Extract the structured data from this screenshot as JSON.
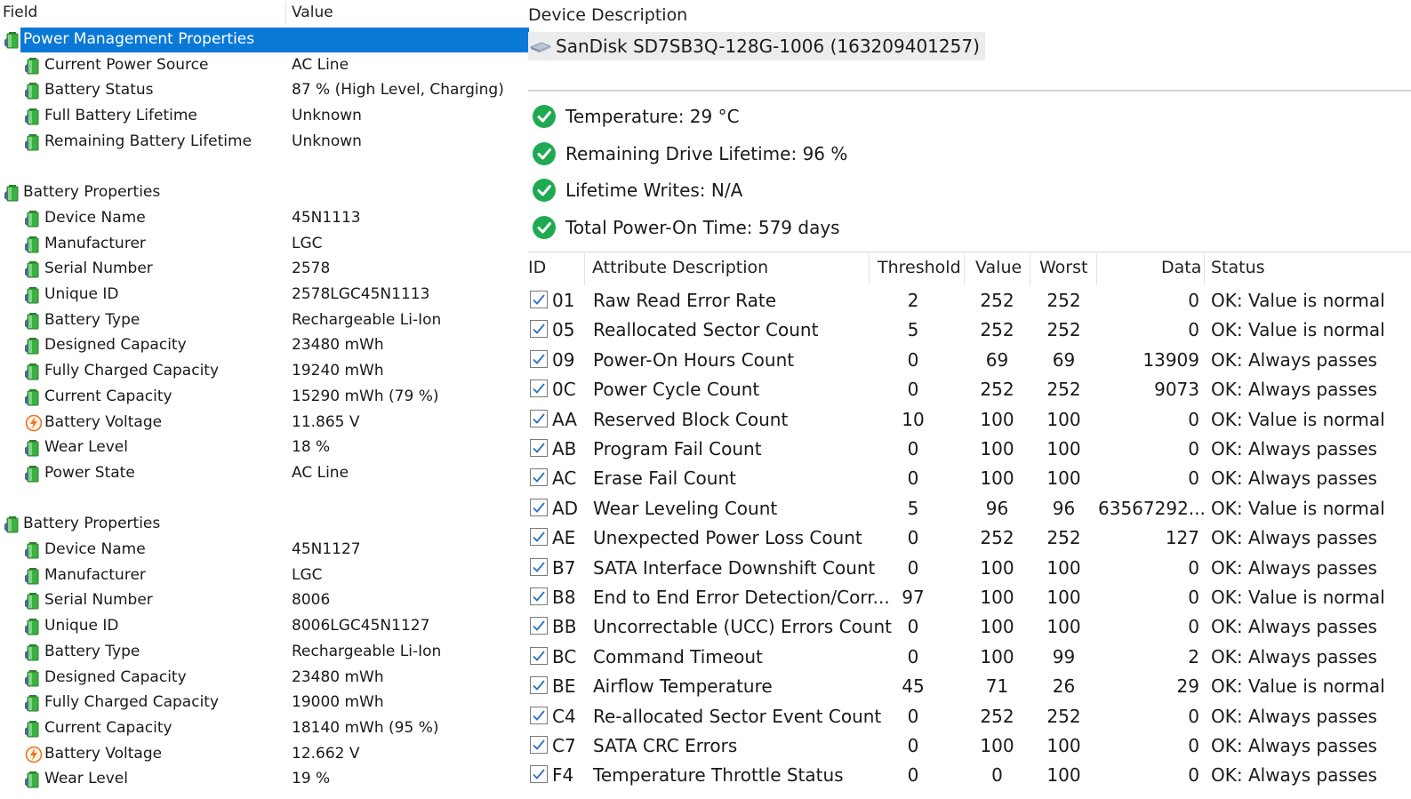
{
  "left_panel": {
    "header": {
      "field": "Field",
      "value": "Value"
    },
    "rows": [
      {
        "type": "group",
        "label": "Power Management Properties",
        "value": "",
        "icon": "battery-icon",
        "selected": true
      },
      {
        "type": "child",
        "label": "Current Power Source",
        "value": "AC Line",
        "icon": "battery-icon"
      },
      {
        "type": "child",
        "label": "Battery Status",
        "value": "87 % (High Level, Charging)",
        "icon": "battery-icon"
      },
      {
        "type": "child",
        "label": "Full Battery Lifetime",
        "value": "Unknown",
        "icon": "battery-icon"
      },
      {
        "type": "child",
        "label": "Remaining Battery Lifetime",
        "value": "Unknown",
        "icon": "battery-icon"
      },
      {
        "type": "blank"
      },
      {
        "type": "group",
        "label": "Battery Properties",
        "value": "",
        "icon": "battery-icon"
      },
      {
        "type": "child",
        "label": "Device Name",
        "value": "45N1113",
        "icon": "battery-icon"
      },
      {
        "type": "child",
        "label": "Manufacturer",
        "value": "LGC",
        "icon": "battery-icon"
      },
      {
        "type": "child",
        "label": "Serial Number",
        "value": "2578",
        "icon": "battery-icon"
      },
      {
        "type": "child",
        "label": "Unique ID",
        "value": "2578LGC45N1113",
        "icon": "battery-icon"
      },
      {
        "type": "child",
        "label": "Battery Type",
        "value": "Rechargeable Li-Ion",
        "icon": "battery-icon"
      },
      {
        "type": "child",
        "label": "Designed Capacity",
        "value": "23480 mWh",
        "icon": "battery-icon"
      },
      {
        "type": "child",
        "label": "Fully Charged Capacity",
        "value": "19240 mWh",
        "icon": "battery-icon"
      },
      {
        "type": "child",
        "label": "Current Capacity",
        "value": "15290 mWh  (79 %)",
        "icon": "battery-icon"
      },
      {
        "type": "child",
        "label": "Battery Voltage",
        "value": "11.865 V",
        "icon": "voltage-icon"
      },
      {
        "type": "child",
        "label": "Wear Level",
        "value": "18 %",
        "icon": "battery-icon"
      },
      {
        "type": "child",
        "label": "Power State",
        "value": "AC Line",
        "icon": "battery-icon"
      },
      {
        "type": "blank"
      },
      {
        "type": "group",
        "label": "Battery Properties",
        "value": "",
        "icon": "battery-icon"
      },
      {
        "type": "child",
        "label": "Device Name",
        "value": "45N1127",
        "icon": "battery-icon"
      },
      {
        "type": "child",
        "label": "Manufacturer",
        "value": "LGC",
        "icon": "battery-icon"
      },
      {
        "type": "child",
        "label": "Serial Number",
        "value": "8006",
        "icon": "battery-icon"
      },
      {
        "type": "child",
        "label": "Unique ID",
        "value": "8006LGC45N1127",
        "icon": "battery-icon"
      },
      {
        "type": "child",
        "label": "Battery Type",
        "value": "Rechargeable Li-Ion",
        "icon": "battery-icon"
      },
      {
        "type": "child",
        "label": "Designed Capacity",
        "value": "23480 mWh",
        "icon": "battery-icon"
      },
      {
        "type": "child",
        "label": "Fully Charged Capacity",
        "value": "19000 mWh",
        "icon": "battery-icon"
      },
      {
        "type": "child",
        "label": "Current Capacity",
        "value": "18140 mWh  (95 %)",
        "icon": "battery-icon"
      },
      {
        "type": "child",
        "label": "Battery Voltage",
        "value": "12.662 V",
        "icon": "voltage-icon"
      },
      {
        "type": "child",
        "label": "Wear Level",
        "value": "19 %",
        "icon": "battery-icon"
      }
    ]
  },
  "right_panel": {
    "device_description_label": "Device Description",
    "device_name": "SanDisk SD7SB3Q-128G-1006 (163209401257)",
    "device_icon": "drive-icon",
    "status_items": [
      {
        "text": "Temperature: 29 °C",
        "icon": "ok-check-icon"
      },
      {
        "text": "Remaining Drive Lifetime: 96 %",
        "icon": "ok-check-icon"
      },
      {
        "text": "Lifetime Writes: N/A",
        "icon": "ok-check-icon"
      },
      {
        "text": "Total Power-On Time: 579 days",
        "icon": "ok-check-icon"
      }
    ],
    "table": {
      "headers": {
        "id": "ID",
        "description": "Attribute Description",
        "threshold": "Threshold",
        "value": "Value",
        "worst": "Worst",
        "data": "Data",
        "status": "Status"
      },
      "rows": [
        {
          "id": "01",
          "description": "Raw Read Error Rate",
          "threshold": "2",
          "value": "252",
          "worst": "252",
          "data": "0",
          "status": "OK: Value is normal",
          "checked": true
        },
        {
          "id": "05",
          "description": "Reallocated Sector Count",
          "threshold": "5",
          "value": "252",
          "worst": "252",
          "data": "0",
          "status": "OK: Value is normal",
          "checked": true
        },
        {
          "id": "09",
          "description": "Power-On Hours Count",
          "threshold": "0",
          "value": "69",
          "worst": "69",
          "data": "13909",
          "status": "OK: Always passes",
          "checked": true
        },
        {
          "id": "0C",
          "description": "Power Cycle Count",
          "threshold": "0",
          "value": "252",
          "worst": "252",
          "data": "9073",
          "status": "OK: Always passes",
          "checked": true
        },
        {
          "id": "AA",
          "description": "Reserved Block Count",
          "threshold": "10",
          "value": "100",
          "worst": "100",
          "data": "0",
          "status": "OK: Value is normal",
          "checked": true
        },
        {
          "id": "AB",
          "description": "Program Fail Count",
          "threshold": "0",
          "value": "100",
          "worst": "100",
          "data": "0",
          "status": "OK: Always passes",
          "checked": true
        },
        {
          "id": "AC",
          "description": "Erase Fail Count",
          "threshold": "0",
          "value": "100",
          "worst": "100",
          "data": "0",
          "status": "OK: Always passes",
          "checked": true
        },
        {
          "id": "AD",
          "description": "Wear Leveling Count",
          "threshold": "5",
          "value": "96",
          "worst": "96",
          "data": "63567292...",
          "status": "OK: Value is normal",
          "checked": true
        },
        {
          "id": "AE",
          "description": "Unexpected Power Loss Count",
          "threshold": "0",
          "value": "252",
          "worst": "252",
          "data": "127",
          "status": "OK: Always passes",
          "checked": true
        },
        {
          "id": "B7",
          "description": "SATA Interface Downshift Count",
          "threshold": "0",
          "value": "100",
          "worst": "100",
          "data": "0",
          "status": "OK: Always passes",
          "checked": true
        },
        {
          "id": "B8",
          "description": "End to End Error Detection/Corr...",
          "threshold": "97",
          "value": "100",
          "worst": "100",
          "data": "0",
          "status": "OK: Value is normal",
          "checked": true
        },
        {
          "id": "BB",
          "description": "Uncorrectable (UCC) Errors Count",
          "threshold": "0",
          "value": "100",
          "worst": "100",
          "data": "0",
          "status": "OK: Always passes",
          "checked": true
        },
        {
          "id": "BC",
          "description": "Command Timeout",
          "threshold": "0",
          "value": "100",
          "worst": "99",
          "data": "2",
          "status": "OK: Always passes",
          "checked": true
        },
        {
          "id": "BE",
          "description": "Airflow Temperature",
          "threshold": "45",
          "value": "71",
          "worst": "26",
          "data": "29",
          "status": "OK: Value is normal",
          "checked": true
        },
        {
          "id": "C4",
          "description": "Re-allocated Sector Event Count",
          "threshold": "0",
          "value": "252",
          "worst": "252",
          "data": "0",
          "status": "OK: Always passes",
          "checked": true
        },
        {
          "id": "C7",
          "description": "SATA CRC Errors",
          "threshold": "0",
          "value": "100",
          "worst": "100",
          "data": "0",
          "status": "OK: Always passes",
          "checked": true
        },
        {
          "id": "F4",
          "description": "Temperature Throttle Status",
          "threshold": "0",
          "value": "0",
          "worst": "100",
          "data": "0",
          "status": "OK: Always passes",
          "checked": true
        }
      ]
    }
  },
  "colors": {
    "selection": "#0a78d7",
    "ok_green": "#1faa52",
    "battery_green": "#3cb043",
    "voltage_orange": "#e87722"
  }
}
